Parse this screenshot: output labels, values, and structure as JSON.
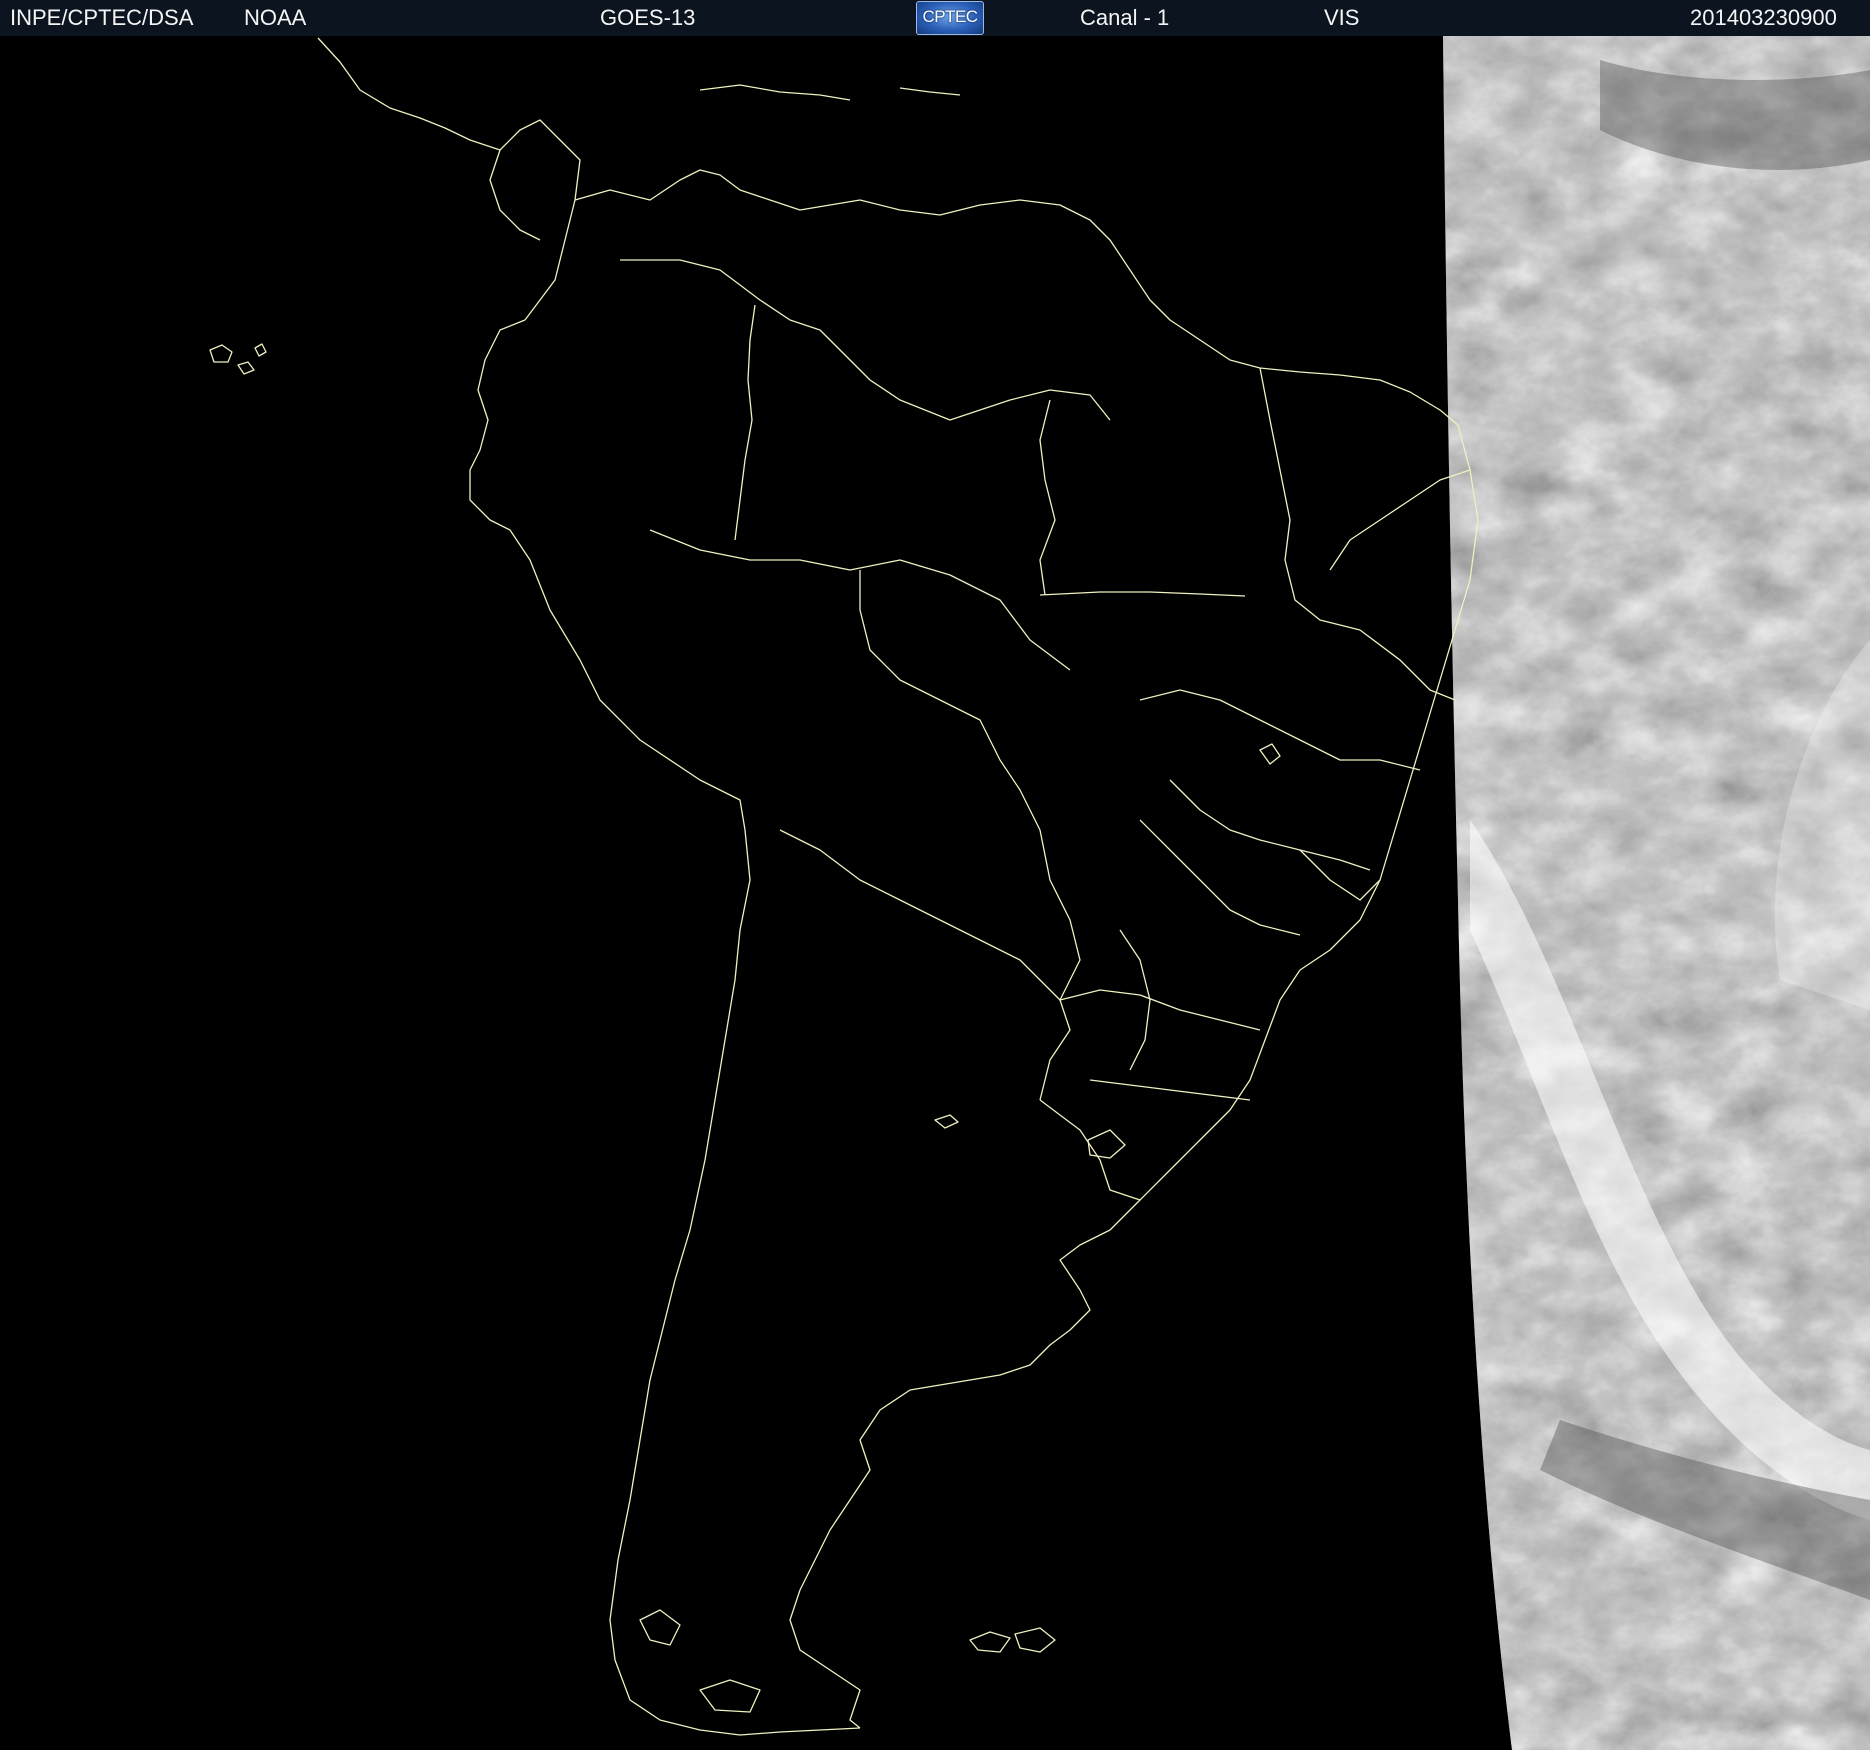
{
  "header": {
    "source": "INPE/CPTEC/DSA",
    "agency": "NOAA",
    "satellite": "GOES-13",
    "logo_text": "CPTEC",
    "channel": "Canal - 1",
    "band": "VIS",
    "timestamp": "201403230900"
  },
  "map": {
    "region": "South America",
    "background_color": "#000000",
    "outline_color": "#f0f0c0",
    "cloud_colors": [
      "#4a4a4a",
      "#8a8a8a",
      "#d8d8d8"
    ]
  }
}
